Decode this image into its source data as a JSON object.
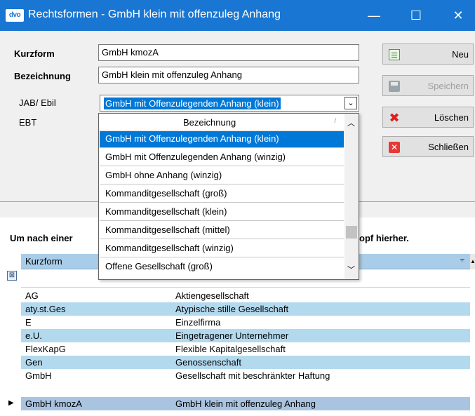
{
  "window": {
    "logo": "dvo",
    "title": "Rechtsformen - GmbH klein mit offenzuleg Anhang",
    "minimize": "—",
    "maximize": "☐",
    "close": "✕"
  },
  "form": {
    "kurzform_label": "Kurzform",
    "kurzform_value": "GmbH kmozA",
    "bezeichnung_label": "Bezeichnung",
    "bezeichnung_value": "GmbH klein mit offenzuleg Anhang",
    "jab_label": "JAB/ Ebil",
    "jab_value": "GmbH mit Offenzulegenden Anhang (klein)",
    "ebt_label": "EBT"
  },
  "buttons": {
    "neu": "Neu",
    "speichern": "Speichern",
    "loeschen": "Löschen",
    "schliessen": "Schließen"
  },
  "dropdown": {
    "header": "Bezeichnung",
    "items": [
      "GmbH mit Offenzulegenden Anhang (klein)",
      "GmbH mit Offenzulegenden Anhang (winzig)",
      "GmbH ohne Anhang (winzig)",
      "Kommanditgesellschaft (groß)",
      "Kommanditgesellschaft (klein)",
      "Kommanditgesellschaft (mittel)",
      "Kommanditgesellschaft (winzig)",
      "Offene Gesellschaft (groß)"
    ]
  },
  "grouping": {
    "text_left": "Um nach einer",
    "text_right": "opf hierher."
  },
  "grid": {
    "col_kurzform": "Kurzform",
    "rows": [
      {
        "kurz": "AG",
        "bez": "Aktiengesellschaft"
      },
      {
        "kurz": "aty.st.Ges",
        "bez": "Atypische stille Gesellschaft"
      },
      {
        "kurz": "E",
        "bez": "Einzelfirma"
      },
      {
        "kurz": "e.U.",
        "bez": "Eingetragener Unternehmer"
      },
      {
        "kurz": "FlexKapG",
        "bez": "Flexible Kapitalgesellschaft"
      },
      {
        "kurz": "Gen",
        "bez": "Genossenschaft"
      },
      {
        "kurz": "GmbH",
        "bez": "Gesellschaft mit beschränkter Haftung"
      },
      {
        "kurz": "GmbH kmozA",
        "bez": "GmbH klein mit offenzuleg Anhang"
      }
    ]
  }
}
